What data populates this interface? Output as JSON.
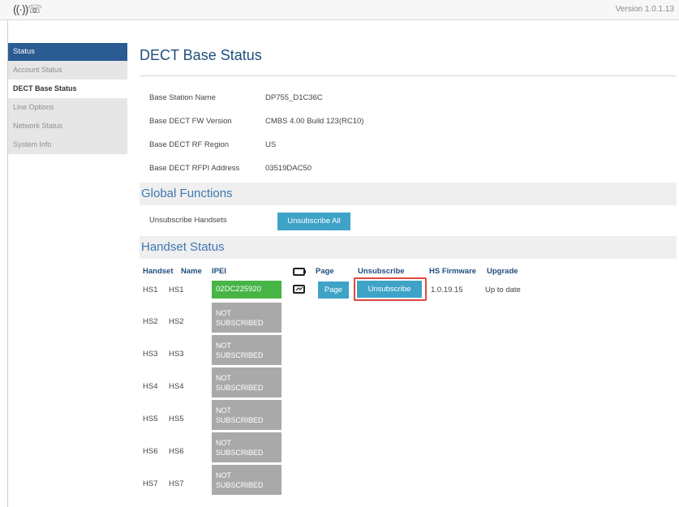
{
  "header": {
    "logo_glyph": "((·))☏",
    "version": "Version 1.0.1.13"
  },
  "sidebar": {
    "title": "Status",
    "items": [
      {
        "label": "Account Status",
        "active": false
      },
      {
        "label": "DECT Base Status",
        "active": true
      },
      {
        "label": "Line Options",
        "active": false
      },
      {
        "label": "Network Status",
        "active": false
      },
      {
        "label": "System Info",
        "active": false
      }
    ]
  },
  "page": {
    "title": "DECT Base Status"
  },
  "base_info": [
    {
      "label": "Base Station Name",
      "value": "DP755_D1C36C"
    },
    {
      "label": "Base DECT FW Version",
      "value": "CMBS 4.00 Build 123(RC10)"
    },
    {
      "label": "Base DECT RF Region",
      "value": "US"
    },
    {
      "label": "Base DECT RFPI Address",
      "value": "03519DAC50"
    }
  ],
  "global_functions": {
    "title": "Global Functions",
    "unsubscribe_label": "Unsubscribe Handsets",
    "unsubscribe_all_button": "Unsubscribe All"
  },
  "handset_status": {
    "title": "Handset Status",
    "columns": {
      "handset": "Handset",
      "name": "Name",
      "ipei": "IPEI",
      "battery_icon": "battery-icon",
      "page": "Page",
      "unsubscribe": "Unsubscribe",
      "hs_firmware": "HS Firmware",
      "upgrade": "Upgrade"
    },
    "hs1": {
      "id": "HS1",
      "name": "HS1",
      "ipei": "02DC225920",
      "page_button": "Page",
      "unsubscribe_button": "Unsubscribe",
      "firmware": "1.0.19.15",
      "upgrade": "Up to date"
    },
    "not_subscribed": [
      {
        "id": "HS2",
        "name": "HS2",
        "status_line1": "NOT",
        "status_line2": "SUBSCRIBED"
      },
      {
        "id": "HS3",
        "name": "HS3",
        "status_line1": "NOT",
        "status_line2": "SUBSCRIBED"
      },
      {
        "id": "HS4",
        "name": "HS4",
        "status_line1": "NOT",
        "status_line2": "SUBSCRIBED"
      },
      {
        "id": "HS5",
        "name": "HS5",
        "status_line1": "NOT",
        "status_line2": "SUBSCRIBED"
      },
      {
        "id": "HS6",
        "name": "HS6",
        "status_line1": "NOT",
        "status_line2": "SUBSCRIBED"
      },
      {
        "id": "HS7",
        "name": "HS7",
        "status_line1": "NOT",
        "status_line2": "SUBSCRIBED"
      }
    ]
  },
  "colors": {
    "nav_active": "#2a5b93",
    "button": "#3fa3c8",
    "subscribed": "#46b546",
    "not_subscribed": "#a9a9a9",
    "highlight": "#e0483a",
    "section_title": "#3d78b0"
  }
}
